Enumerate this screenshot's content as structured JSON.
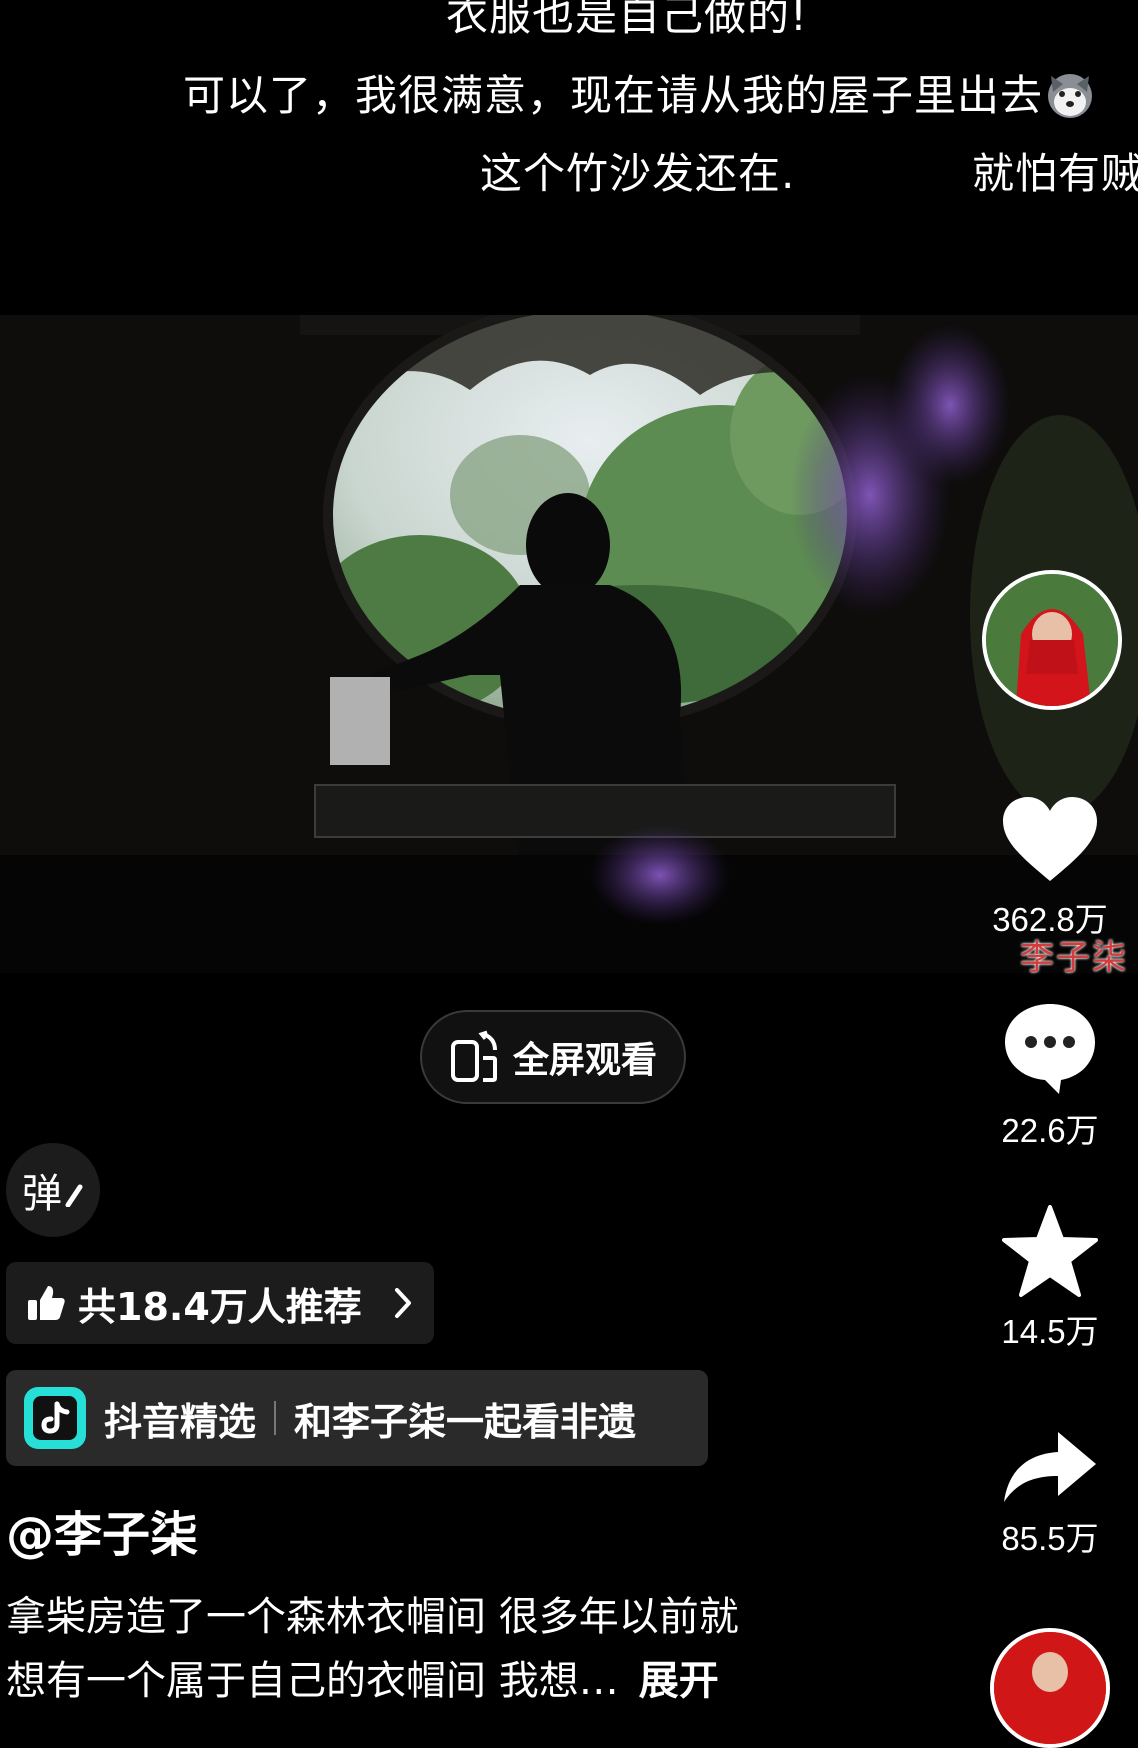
{
  "danmaku": [
    "衣服也是自己做的!",
    "可以了，我很满意，现在请从我的屋子里出去",
    "这个竹沙发还在.",
    "就怕有贼"
  ],
  "danmaku_emoji": "husky-face-emoji",
  "video": {
    "watermark": "李子柒"
  },
  "rail": {
    "like_count": "362.8万",
    "comment_count": "22.6万",
    "favorite_count": "14.5万",
    "share_count": "85.5万",
    "icons": [
      "heart-icon",
      "comment-icon",
      "star-icon",
      "share-icon"
    ]
  },
  "fullscreen": {
    "label": "全屏观看"
  },
  "bullet_toggle": {
    "label": "弹"
  },
  "recommend": {
    "label": "共18.4万人推荐"
  },
  "collection": {
    "app_name": "抖音精选",
    "topic": "和李子柒一起看非遗"
  },
  "author": {
    "handle": "@李子柒"
  },
  "caption": {
    "line1": "拿柴房造了一个森林衣帽间 很多年以前就",
    "line2": "想有一个属于自己的衣帽间 我想…",
    "more": "展开"
  },
  "colors": {
    "background": "#000000",
    "chip": "#1c1c1c",
    "douyin_accent": "#26e0d8"
  }
}
